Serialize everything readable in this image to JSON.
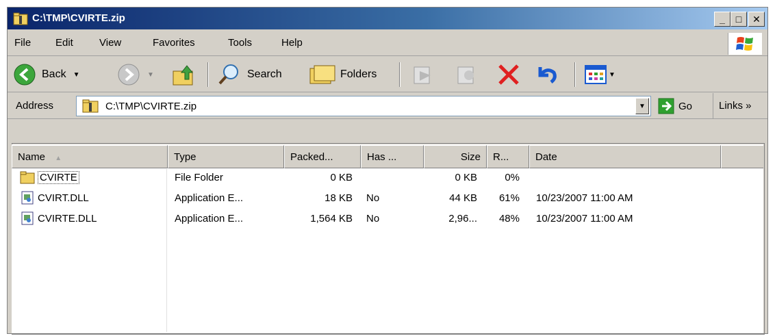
{
  "window": {
    "title": "C:\\TMP\\CVIRTE.zip",
    "min_label": "_",
    "max_label": "□",
    "close_label": "✕"
  },
  "menu": {
    "items": [
      "File",
      "Edit",
      "View",
      "Favorites",
      "Tools",
      "Help"
    ]
  },
  "toolbar": {
    "back_label": "Back",
    "search_label": "Search",
    "folders_label": "Folders"
  },
  "address": {
    "label": "Address",
    "value": "C:\\TMP\\CVIRTE.zip",
    "go_label": "Go",
    "links_label": "Links »"
  },
  "columns": [
    "Name",
    "Type",
    "Packed...",
    "Has ...",
    "Size",
    "R...",
    "Date"
  ],
  "rows": [
    {
      "name": "CVIRTE",
      "type": "File Folder",
      "packed": "0 KB",
      "has": "",
      "size": "0 KB",
      "ratio": "0%",
      "date": ""
    },
    {
      "name": "CVIRT.DLL",
      "type": "Application E...",
      "packed": "18 KB",
      "has": "No",
      "size": "44 KB",
      "ratio": "61%",
      "date": "10/23/2007 11:00 AM"
    },
    {
      "name": "CVIRTE.DLL",
      "type": "Application E...",
      "packed": "1,564 KB",
      "has": "No",
      "size": "2,96...",
      "ratio": "48%",
      "date": "10/23/2007 11:00 AM"
    }
  ],
  "colors": {
    "title_start": "#0a246a",
    "title_end": "#a6caf0",
    "chrome": "#d4d0c8"
  }
}
